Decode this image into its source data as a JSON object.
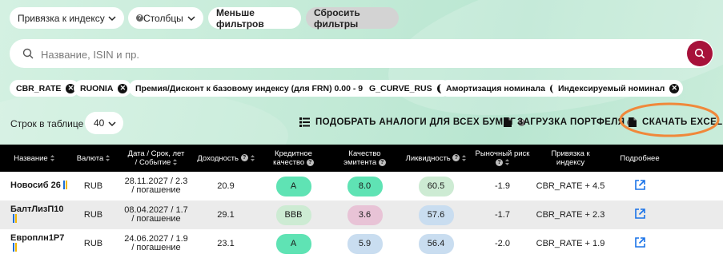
{
  "filters": {
    "index_binding": "Привязка к индексу",
    "columns": "Столбцы",
    "fewer_filters": "Меньше фильтров",
    "reset_filters": "Сбросить фильтры"
  },
  "search": {
    "placeholder": "Название, ISIN и пр."
  },
  "chips": [
    "CBR_RATE",
    "RUONIA",
    "Премия/Дисконт к базовому индексу (для FRN) 0.00 - 9.00",
    "G_CURVE_RUS",
    "Амортизация номинала",
    "Индексируемый номинал"
  ],
  "rows_control": {
    "label": "Строк в таблице",
    "value": "40"
  },
  "actions": {
    "analogs": "ПОДОБРАТЬ АНАЛОГИ ДЛЯ ВСЕХ БУМАГ",
    "portfolio": "ЗАГРУЗКА ПОРТФЕЛЯ",
    "excel": "СКАЧАТЬ EXCEL"
  },
  "table": {
    "headers": {
      "name": "Название",
      "currency": "Валюта",
      "date_line1": "Дата / Срок, лет",
      "date_line2": "/ Событие",
      "yield": "Доходность",
      "credit_line1": "Кредитное",
      "credit_line2": "качество",
      "issuer_line1": "Качество",
      "issuer_line2": "эмитента",
      "liquidity": "Ликвидность",
      "market_risk": "Рыночный риск",
      "binding_line1": "Привязка к",
      "binding_line2": "индексу",
      "more": "Подробнее"
    },
    "rows": [
      {
        "name": "Новосиб 26",
        "currency": "RUB",
        "date_line1": "28.11.2027 / 2.3",
        "date_line2": "/ погашение",
        "yield": "20.9",
        "credit": "A",
        "issuer": "8.0",
        "liquidity": "60.5",
        "market_risk": "-1.9",
        "binding": "CBR_RATE + 4.5"
      },
      {
        "name": "БалтЛизП10",
        "currency": "RUB",
        "date_line1": "08.04.2027 / 1.7",
        "date_line2": "/ погашение",
        "yield": "29.1",
        "credit": "BBB",
        "issuer": "3.6",
        "liquidity": "57.6",
        "market_risk": "-1.7",
        "binding": "CBR_RATE + 2.3"
      },
      {
        "name": "Европлн1Р7",
        "currency": "RUB",
        "date_line1": "24.06.2027 / 1.9",
        "date_line2": "/ погашение",
        "yield": "23.1",
        "credit": "A",
        "issuer": "5.9",
        "liquidity": "56.4",
        "market_risk": "-2.0",
        "binding": "CBR_RATE + 1.9"
      }
    ]
  },
  "colors": {
    "search_button": "#a7113a",
    "badge_green": "#5fe3b4",
    "badge_light_green": "#cdebd3",
    "badge_pink": "#e8c3d6",
    "badge_blue": "#c9ddf0",
    "highlight_ring": "#f0883a",
    "link": "#1a73e8"
  }
}
